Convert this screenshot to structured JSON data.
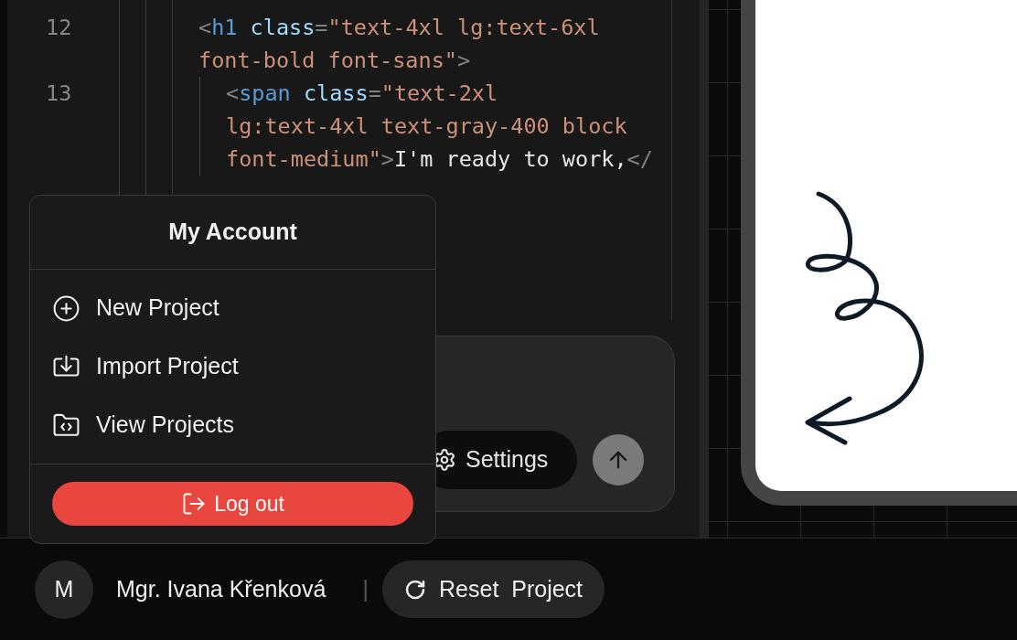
{
  "editor": {
    "lines": [
      {
        "number": "12",
        "rows": [
          {
            "segments": [
              {
                "kind": "punct",
                "text": "<"
              },
              {
                "kind": "tag",
                "text": "h1"
              },
              {
                "kind": "attr",
                "text": " class"
              },
              {
                "kind": "punct",
                "text": "="
              },
              {
                "kind": "string",
                "text": "\"text-4xl lg:text-6xl"
              }
            ]
          },
          {
            "segments": [
              {
                "kind": "string",
                "text": "font-bold font-sans\""
              },
              {
                "kind": "punct",
                "text": ">"
              }
            ]
          }
        ],
        "children": [
          {
            "number": "13",
            "rows": [
              {
                "segments": [
                  {
                    "kind": "punct",
                    "text": "<"
                  },
                  {
                    "kind": "tag",
                    "text": "span"
                  },
                  {
                    "kind": "attr",
                    "text": " class"
                  },
                  {
                    "kind": "punct",
                    "text": "="
                  },
                  {
                    "kind": "string",
                    "text": "\"text-2xl"
                  }
                ]
              },
              {
                "segments": [
                  {
                    "kind": "string",
                    "text": "lg:text-4xl text-gray-400 block"
                  }
                ]
              },
              {
                "segments": [
                  {
                    "kind": "string",
                    "text": "font-medium\""
                  },
                  {
                    "kind": "punct",
                    "text": ">"
                  },
                  {
                    "kind": "text",
                    "text": "I'm ready to work,"
                  },
                  {
                    "kind": "punct",
                    "text": "</"
                  }
                ]
              }
            ]
          }
        ]
      }
    ]
  },
  "chat": {
    "settings_button": "Settings"
  },
  "account_menu": {
    "title": "My Account",
    "items": [
      {
        "kind": "new",
        "label": "New Project"
      },
      {
        "kind": "import",
        "label": "Import Project"
      },
      {
        "kind": "view",
        "label": "View Projects"
      }
    ],
    "logout": "Log out"
  },
  "footer": {
    "avatar": "M",
    "user_name": "Mgr. Ivana Křenková",
    "separator": "|",
    "reset_button": "Reset  Project"
  }
}
